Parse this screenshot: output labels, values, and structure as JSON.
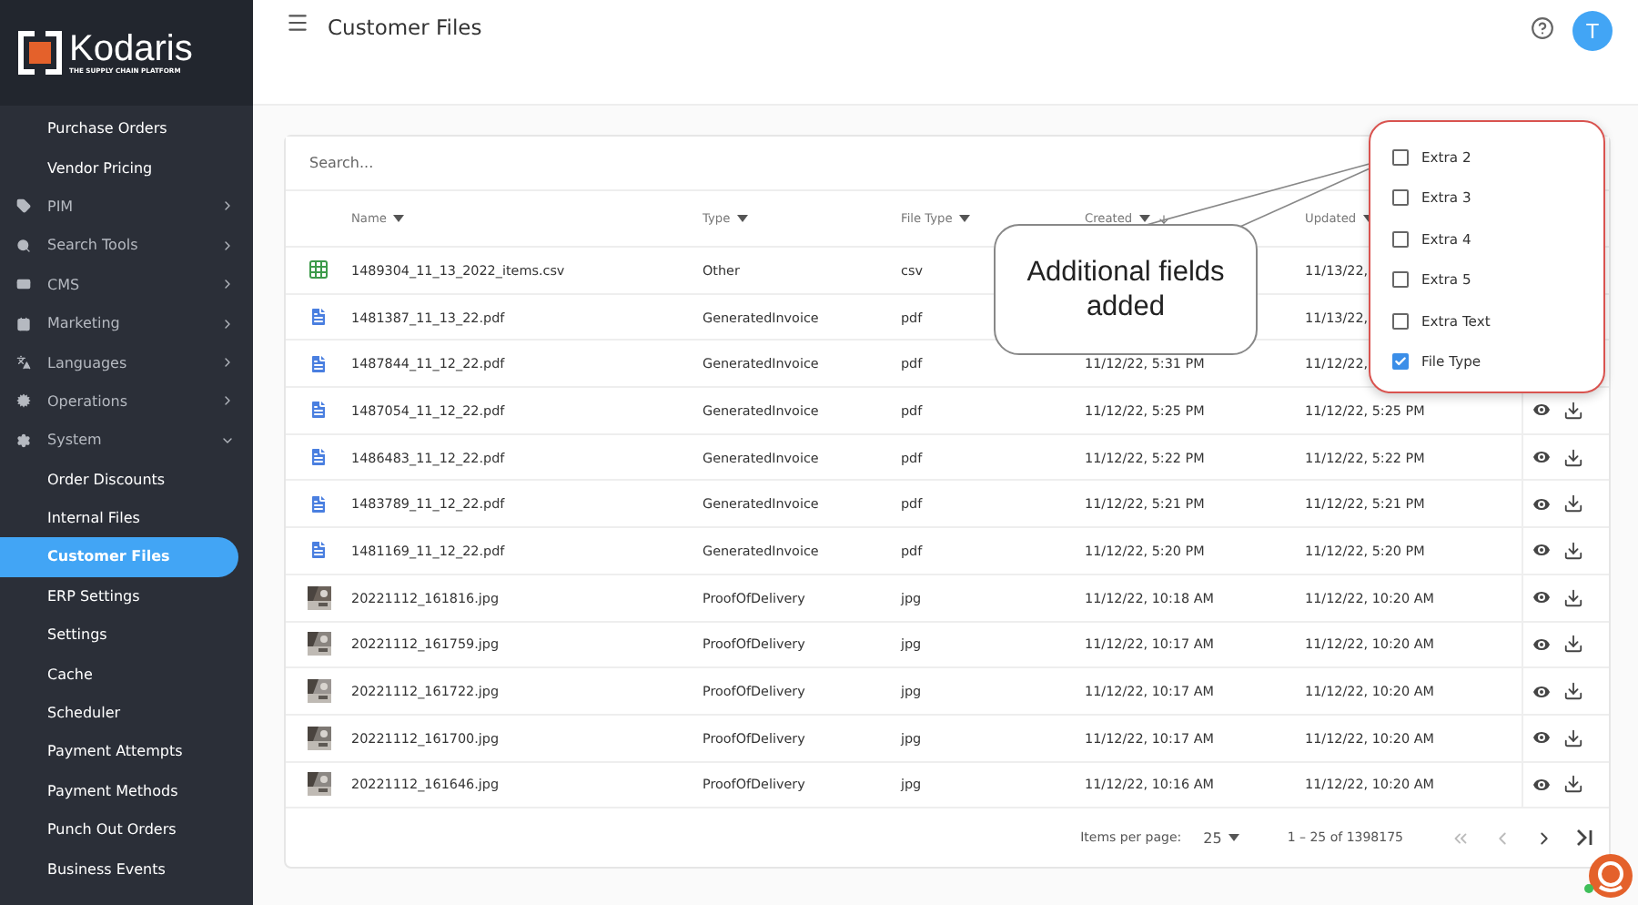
{
  "brand": {
    "name": "Kodaris",
    "tagline": "THE SUPPLY CHAIN PLATFORM"
  },
  "sidebar": {
    "items": [
      {
        "kind": "link",
        "label": "Purchase Orders",
        "selected": false
      },
      {
        "kind": "link",
        "label": "Vendor Pricing",
        "selected": false
      },
      {
        "kind": "section",
        "label": "PIM",
        "expanded": false
      },
      {
        "kind": "section",
        "label": "Search Tools",
        "expanded": false
      },
      {
        "kind": "section",
        "label": "CMS",
        "expanded": false
      },
      {
        "kind": "section",
        "label": "Marketing",
        "expanded": false
      },
      {
        "kind": "section",
        "label": "Languages",
        "expanded": false
      },
      {
        "kind": "section",
        "label": "Operations",
        "expanded": false
      },
      {
        "kind": "section",
        "label": "System",
        "expanded": true
      },
      {
        "kind": "link",
        "label": "Order Discounts",
        "selected": false
      },
      {
        "kind": "link",
        "label": "Internal Files",
        "selected": false
      },
      {
        "kind": "link",
        "label": "Customer Files",
        "selected": true
      },
      {
        "kind": "link",
        "label": "ERP Settings",
        "selected": false
      },
      {
        "kind": "link",
        "label": "Settings",
        "selected": false
      },
      {
        "kind": "link",
        "label": "Cache",
        "selected": false
      },
      {
        "kind": "link",
        "label": "Scheduler",
        "selected": false
      },
      {
        "kind": "link",
        "label": "Payment Attempts",
        "selected": false
      },
      {
        "kind": "link",
        "label": "Payment Methods",
        "selected": false
      },
      {
        "kind": "link",
        "label": "Punch Out Orders",
        "selected": false
      },
      {
        "kind": "link",
        "label": "Business Events",
        "selected": false
      }
    ]
  },
  "header": {
    "title": "Customer Files",
    "avatar": "T"
  },
  "search": {
    "placeholder": "Search..."
  },
  "table": {
    "columns": [
      "Name",
      "Type",
      "File Type",
      "Created",
      "Updated"
    ],
    "rows": [
      {
        "kind": "sheet",
        "name": "1489304_11_13_2022_items.csv",
        "type": "Other",
        "file_type": "csv",
        "created": "",
        "updated": "11/13/22,",
        "actions": false
      },
      {
        "kind": "doc",
        "name": "1481387_11_13_22.pdf",
        "type": "GeneratedInvoice",
        "file_type": "pdf",
        "created": "",
        "updated": "11/13/22,",
        "actions": false
      },
      {
        "kind": "doc",
        "name": "1487844_11_12_22.pdf",
        "type": "GeneratedInvoice",
        "file_type": "pdf",
        "created": "11/12/22, 5:31 PM",
        "updated": "11/12/22,",
        "actions": false
      },
      {
        "kind": "doc",
        "name": "1487054_11_12_22.pdf",
        "type": "GeneratedInvoice",
        "file_type": "pdf",
        "created": "11/12/22, 5:25 PM",
        "updated": "11/12/22, 5:25 PM",
        "actions": true
      },
      {
        "kind": "doc",
        "name": "1486483_11_12_22.pdf",
        "type": "GeneratedInvoice",
        "file_type": "pdf",
        "created": "11/12/22, 5:22 PM",
        "updated": "11/12/22, 5:22 PM",
        "actions": true
      },
      {
        "kind": "doc",
        "name": "1483789_11_12_22.pdf",
        "type": "GeneratedInvoice",
        "file_type": "pdf",
        "created": "11/12/22, 5:21 PM",
        "updated": "11/12/22, 5:21 PM",
        "actions": true
      },
      {
        "kind": "doc",
        "name": "1481169_11_12_22.pdf",
        "type": "GeneratedInvoice",
        "file_type": "pdf",
        "created": "11/12/22, 5:20 PM",
        "updated": "11/12/22, 5:20 PM",
        "actions": true
      },
      {
        "name": "20221112_161816.jpg",
        "type": "ProofOfDelivery",
        "file_type": "jpg",
        "created": "11/12/22, 10:18 AM",
        "updated": "11/12/22, 10:20 AM",
        "actions": true
      },
      {
        "name": "20221112_161759.jpg",
        "type": "ProofOfDelivery",
        "file_type": "jpg",
        "created": "11/12/22, 10:17 AM",
        "updated": "11/12/22, 10:20 AM",
        "actions": true
      },
      {
        "name": "20221112_161722.jpg",
        "type": "ProofOfDelivery",
        "file_type": "jpg",
        "created": "11/12/22, 10:17 AM",
        "updated": "11/12/22, 10:20 AM",
        "actions": true
      },
      {
        "name": "20221112_161700.jpg",
        "type": "ProofOfDelivery",
        "file_type": "jpg",
        "created": "11/12/22, 10:17 AM",
        "updated": "11/12/22, 10:20 AM",
        "actions": true
      },
      {
        "name": "20221112_161646.jpg",
        "type": "ProofOfDelivery",
        "file_type": "jpg",
        "created": "11/12/22, 10:16 AM",
        "updated": "11/12/22, 10:20 AM",
        "actions": true
      }
    ]
  },
  "pagination": {
    "label": "Items per page:",
    "page_size": "25",
    "range": "1 – 25 of 1398175"
  },
  "column_menu": {
    "options": [
      {
        "label": "Extra 2",
        "checked": false
      },
      {
        "label": "Extra 3",
        "checked": false
      },
      {
        "label": "Extra 4",
        "checked": false
      },
      {
        "label": "Extra 5",
        "checked": false
      },
      {
        "label": "Extra Text",
        "checked": false
      },
      {
        "label": "File Type",
        "checked": true
      }
    ]
  },
  "callout": {
    "text": "Additional fields added"
  }
}
